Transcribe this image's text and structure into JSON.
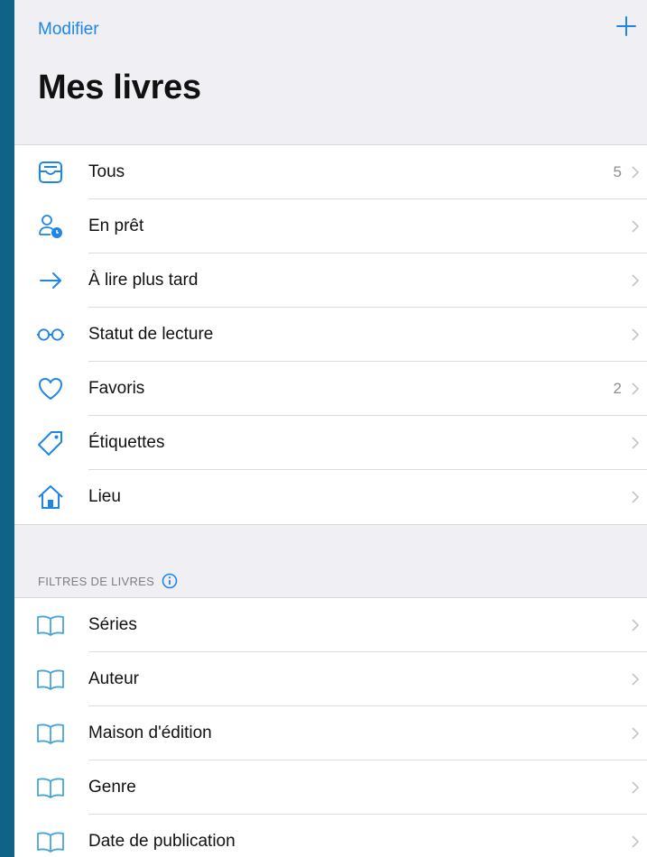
{
  "nav": {
    "edit_label": "Modifier",
    "title": "Mes livres"
  },
  "colors": {
    "accent": "#1f86e8",
    "background": "#efeff4",
    "frame": "#0e6386"
  },
  "library_items": [
    {
      "label": "Tous",
      "count": "5",
      "icon": "tray-icon"
    },
    {
      "label": "En prêt",
      "count": "",
      "icon": "person-clock-icon"
    },
    {
      "label": "À lire plus tard",
      "count": "",
      "icon": "arrow-right-icon"
    },
    {
      "label": "Statut de lecture",
      "count": "",
      "icon": "glasses-icon"
    },
    {
      "label": "Favoris",
      "count": "2",
      "icon": "heart-icon"
    },
    {
      "label": "Étiquettes",
      "count": "",
      "icon": "tag-icon"
    },
    {
      "label": "Lieu",
      "count": "",
      "icon": "house-icon"
    }
  ],
  "filters": {
    "header": "FILTRES DE LIVRES",
    "items": [
      {
        "label": "Séries",
        "icon": "book-icon"
      },
      {
        "label": "Auteur",
        "icon": "book-icon"
      },
      {
        "label": "Maison d'édition",
        "icon": "book-icon"
      },
      {
        "label": "Genre",
        "icon": "book-icon"
      },
      {
        "label": "Date de publication",
        "icon": "book-icon"
      }
    ]
  }
}
